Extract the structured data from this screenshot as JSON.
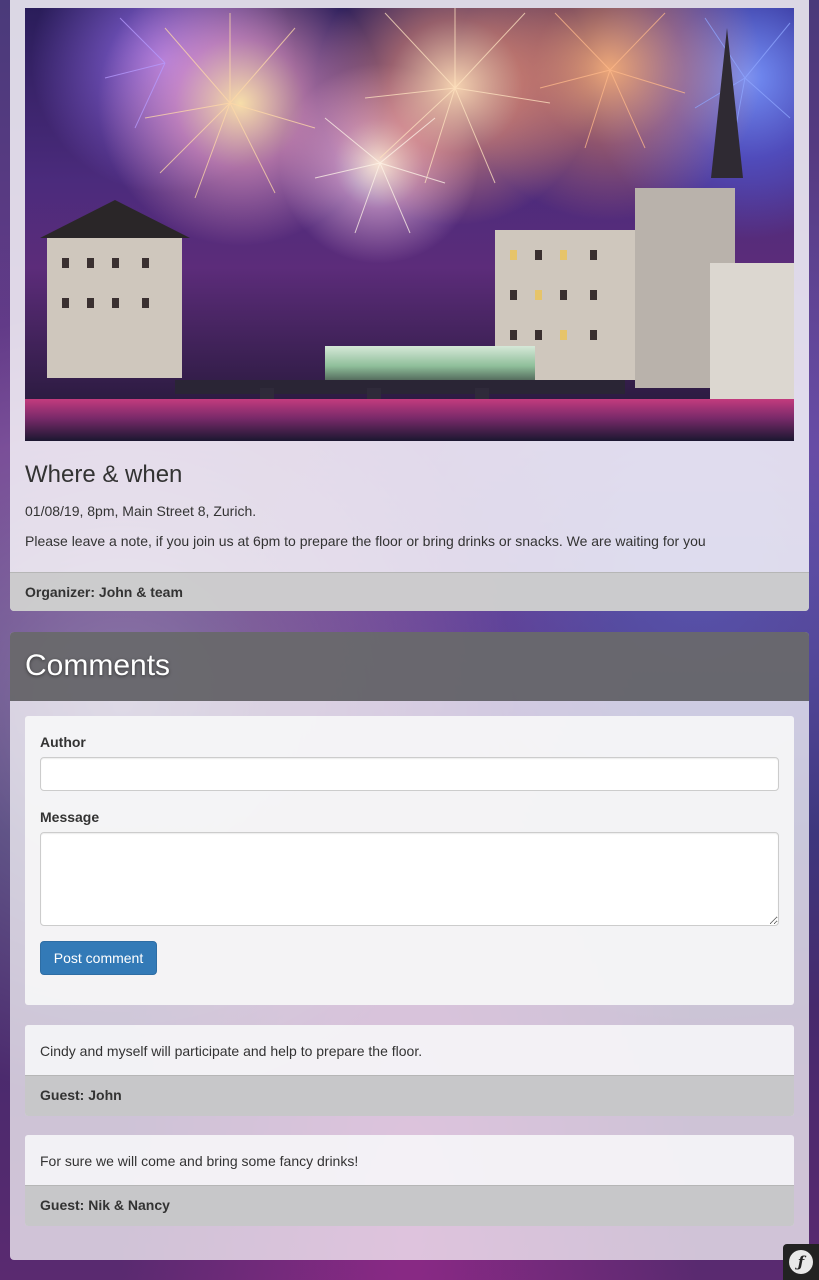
{
  "event": {
    "where_heading": "Where & when",
    "when_text": "01/08/19, 8pm, Main Street 8, Zurich.",
    "note_text": "Please leave a note, if you join us at 6pm to prepare the floor or bring drinks or snacks. We are waiting for you",
    "organizer": "Organizer: John & team"
  },
  "comments": {
    "title": "Comments",
    "form": {
      "author_label": "Author",
      "author_value": "",
      "message_label": "Message",
      "message_value": "",
      "submit_label": "Post comment"
    },
    "items": [
      {
        "text": "Cindy and myself will participate and help to prepare the floor.",
        "guest": "Guest: John"
      },
      {
        "text": "For sure we will come and bring some fancy drinks!",
        "guest": "Guest: Nik & Nancy"
      }
    ]
  },
  "toolbar": {
    "icon": "symfony-logo-icon"
  },
  "colors": {
    "primary_button": "#337ab7",
    "comments_header": "#505054",
    "footer_bar": "#c8c8c8"
  }
}
